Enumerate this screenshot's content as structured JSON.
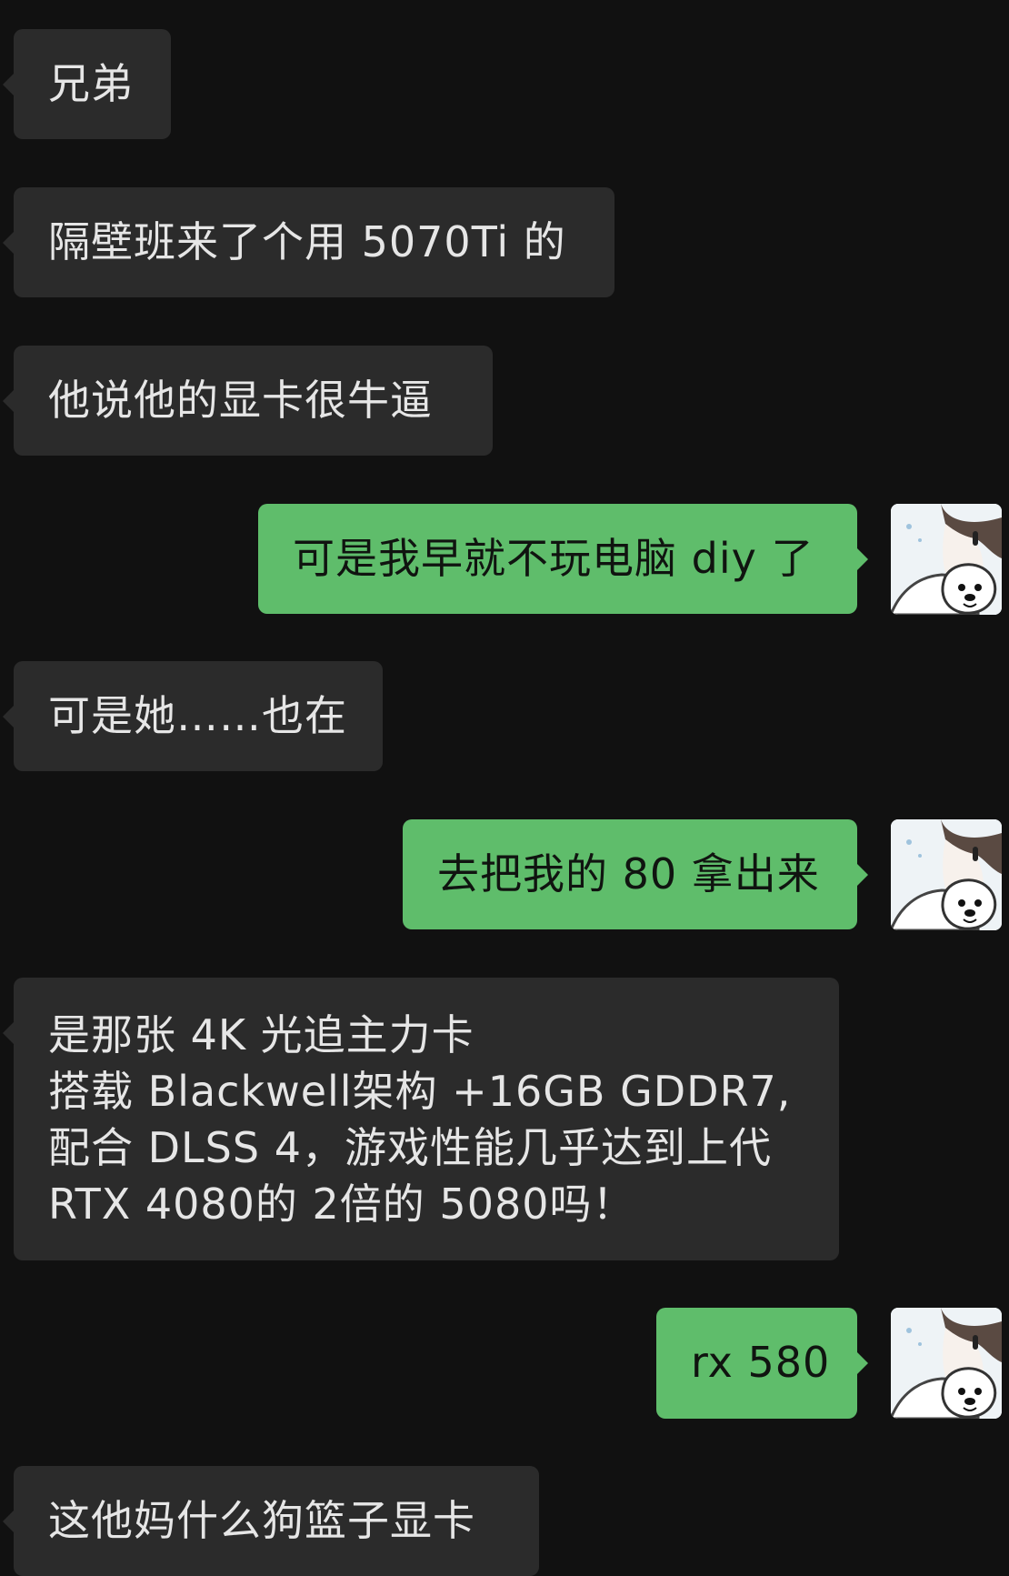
{
  "messages": [
    {
      "side": "left",
      "text": "兄弟"
    },
    {
      "side": "left",
      "text": "隔壁班来了个用 5070Ti 的"
    },
    {
      "side": "left",
      "text": "他说他的显卡很牛逼"
    },
    {
      "side": "right",
      "text": "可是我早就不玩电脑 diy 了",
      "avatar": "user-avatar"
    },
    {
      "side": "left",
      "text": "可是她……也在"
    },
    {
      "side": "right",
      "text": "去把我的 80 拿出来",
      "avatar": "user-avatar"
    },
    {
      "side": "left",
      "lines": [
        "是那张 4K 光追主力卡",
        "搭载 Blackwell架构 +16GB GDDR7,",
        "配合 DLSS 4，游戏性能几乎达到上代",
        "RTX 4080的 2倍的 5080吗！"
      ]
    },
    {
      "side": "right",
      "text": "rx 580",
      "avatar": "user-avatar"
    },
    {
      "side": "left",
      "text": "这他妈什么狗篮子显卡"
    }
  ],
  "colors": {
    "background": "#111111",
    "incoming_bubble": "#2b2b2b",
    "incoming_text": "#e6e6e6",
    "outgoing_bubble": "#5fbd6b",
    "outgoing_text": "#101410"
  }
}
